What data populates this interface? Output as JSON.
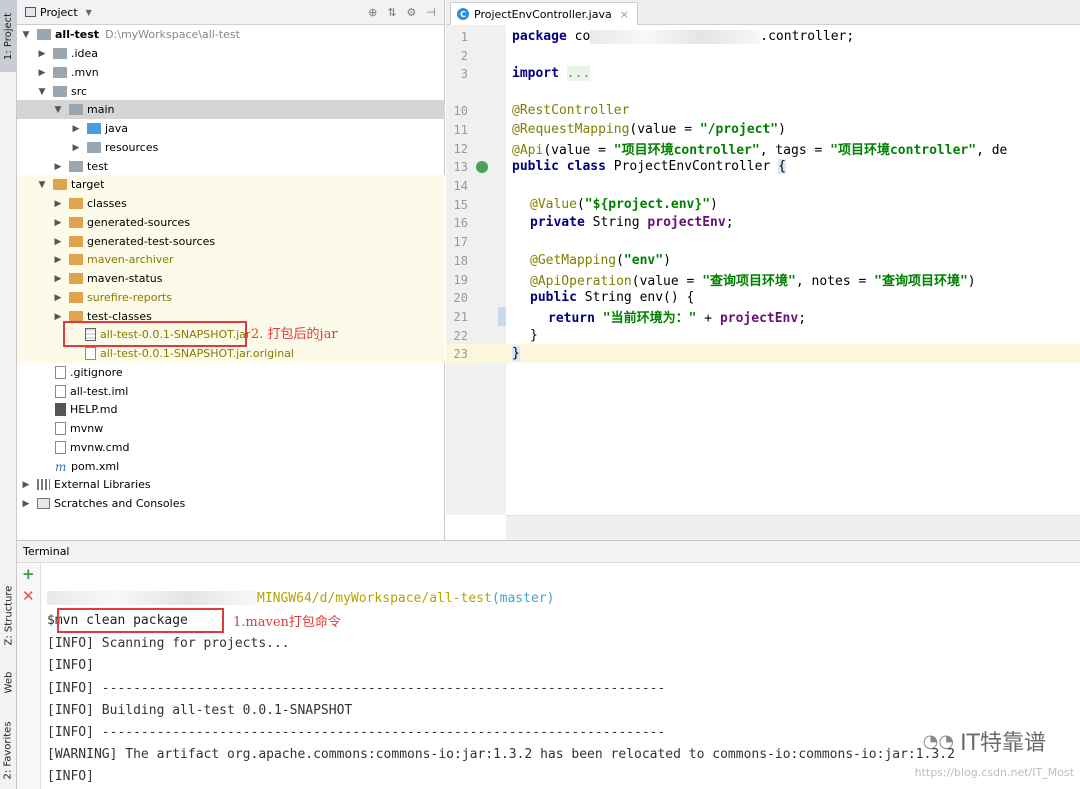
{
  "left_strip": {
    "project_tab": "1: Project",
    "structure_tab": "Z: Structure",
    "web_tab": "Web",
    "favorites_tab": "2: Favorites"
  },
  "project_panel": {
    "title": "Project",
    "tree": [
      {
        "label": "all-test",
        "path": "D:\\myWorkspace\\all-test"
      },
      {
        "label": ".idea"
      },
      {
        "label": ".mvn"
      },
      {
        "label": "src"
      },
      {
        "label": "main"
      },
      {
        "label": "java"
      },
      {
        "label": "resources"
      },
      {
        "label": "test"
      },
      {
        "label": "target"
      },
      {
        "label": "classes"
      },
      {
        "label": "generated-sources"
      },
      {
        "label": "generated-test-sources"
      },
      {
        "label": "maven-archiver"
      },
      {
        "label": "maven-status"
      },
      {
        "label": "surefire-reports"
      },
      {
        "label": "test-classes"
      },
      {
        "label": "all-test-0.0.1-SNAPSHOT.jar"
      },
      {
        "label": "all-test-0.0.1-SNAPSHOT.jar.original"
      },
      {
        "label": ".gitignore"
      },
      {
        "label": "all-test.iml"
      },
      {
        "label": "HELP.md"
      },
      {
        "label": "mvnw"
      },
      {
        "label": "mvnw.cmd"
      },
      {
        "label": "pom.xml"
      },
      {
        "label": "External Libraries"
      },
      {
        "label": "Scratches and Consoles"
      }
    ],
    "annotation_jar": "2. 打包后的jar"
  },
  "editor": {
    "tab_label": "ProjectEnvController.java",
    "lines": [
      {
        "n": "1",
        "package_kw": "package",
        "pkg_tail": ".controller;"
      },
      {
        "n": "2"
      },
      {
        "n": "3",
        "import_kw": "import",
        "import_dots": "..."
      },
      {
        "n": "10",
        "text": "@RestController"
      },
      {
        "n": "11",
        "ann": "@RequestMapping",
        "open": "(value = ",
        "val": "\"/project\"",
        "close": ")"
      },
      {
        "n": "12",
        "ann": "@Api",
        "open": "(value = ",
        "val": "\"项目环境controller\"",
        "mid": ", tags = ",
        "val2": "\"项目环境controller\"",
        "tail": ", de"
      },
      {
        "n": "13",
        "kw": "public class",
        "name": " ProjectEnvController ",
        "brace": "{"
      },
      {
        "n": "14"
      },
      {
        "n": "15",
        "ann": "@Value",
        "open": "(",
        "val": "\"${project.env}\"",
        "close": ")"
      },
      {
        "n": "16",
        "kw": "private",
        "type": " String ",
        "field": "projectEnv",
        "semi": ";"
      },
      {
        "n": "17"
      },
      {
        "n": "18",
        "ann": "@GetMapping",
        "open": "(",
        "val": "\"env\"",
        "close": ")"
      },
      {
        "n": "19",
        "ann": "@ApiOperation",
        "open": "(value = ",
        "val": "\"查询项目环境\"",
        "mid": ", notes = ",
        "val2": "\"查询项目环境\"",
        "close": ")"
      },
      {
        "n": "20",
        "kw": "public",
        "rest": " String env() {"
      },
      {
        "n": "21",
        "kw": "return",
        "val": " \"当前环境为：\"",
        "plus": " + ",
        "field": "projectEnv",
        "semi": ";"
      },
      {
        "n": "22",
        "text": "}"
      },
      {
        "n": "23",
        "text": "}"
      }
    ]
  },
  "terminal": {
    "title": "Terminal",
    "prompt_host": "MINGW64",
    "prompt_path": "/d/myWorkspace/all-test",
    "prompt_branch": "(master)",
    "prompt_symbol": "$",
    "command": "mvn clean package",
    "annotation_cmd": "1.maven打包命令",
    "output": [
      "[INFO] Scanning for projects...",
      "[INFO]",
      "[INFO] ------------------------------------------------------------------------",
      "[INFO] Building all-test 0.0.1-SNAPSHOT",
      "[INFO] ------------------------------------------------------------------------",
      "[WARNING] The artifact org.apache.commons:commons-io:jar:1.3.2 has been relocated to commons-io:commons-io:jar:1.3.2",
      "[INFO]"
    ]
  },
  "watermark": {
    "brand": "IT特靠谱",
    "url": "https://blog.csdn.net/IT_Most"
  }
}
